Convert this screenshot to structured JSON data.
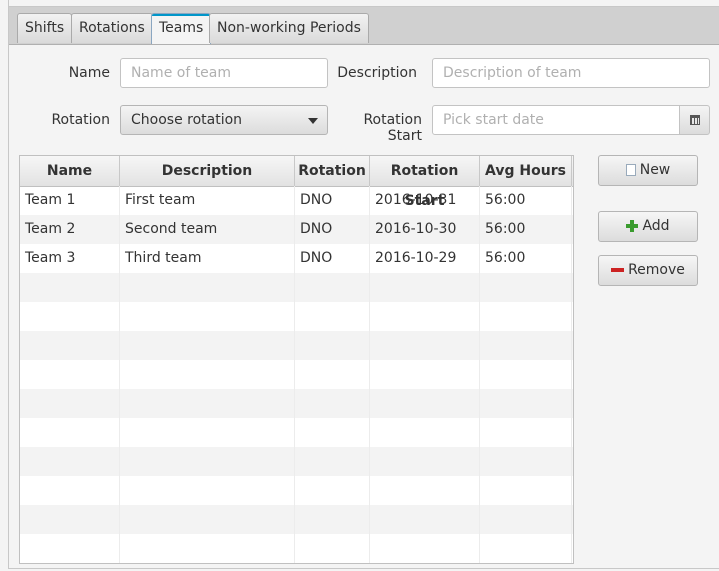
{
  "tabs": [
    {
      "label": "Shifts"
    },
    {
      "label": "Rotations"
    },
    {
      "label": "Teams"
    },
    {
      "label": "Non-working Periods"
    }
  ],
  "form": {
    "name_label": "Name",
    "name_placeholder": "Name of team",
    "description_label": "Description",
    "description_placeholder": "Description of team",
    "rotation_label": "Rotation",
    "rotation_value": "Choose rotation",
    "rotation_start_label": "Rotation Start",
    "rotation_start_placeholder": "Pick start date"
  },
  "table": {
    "columns": [
      "Name",
      "Description",
      "Rotation",
      "Rotation Start",
      "Avg Hours"
    ],
    "rows": [
      [
        "Team 1",
        "First team",
        "DNO",
        "2016-10-31",
        "56:00"
      ],
      [
        "Team 2",
        "Second team",
        "DNO",
        "2016-10-30",
        "56:00"
      ],
      [
        "Team 3",
        "Third team",
        "DNO",
        "2016-10-29",
        "56:00"
      ]
    ]
  },
  "buttons": {
    "new_label": "New",
    "add_label": "Add",
    "remove_label": "Remove"
  }
}
